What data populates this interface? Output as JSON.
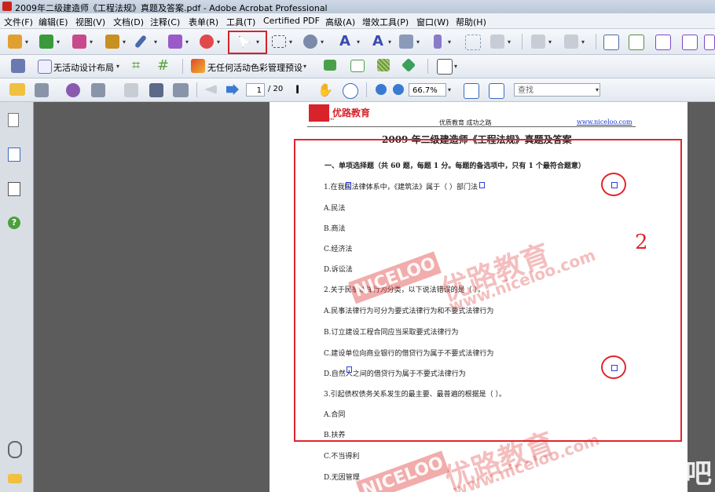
{
  "window": {
    "title": "2009年二级建造师《工程法规》真题及答案.pdf - Adobe Acrobat Professional"
  },
  "menubar": [
    "文件(F)",
    "编辑(E)",
    "视图(V)",
    "文档(D)",
    "注释(C)",
    "表单(R)",
    "工具(T)",
    "Certified PDF",
    "高级(A)",
    "增效工具(P)",
    "窗口(W)",
    "帮助(H)"
  ],
  "toolbar2": {
    "layout_label": "无活动设计布局",
    "color_label": "无任何活动色彩管理预设"
  },
  "toolbar3": {
    "page_current": "1",
    "page_total": "/ 20",
    "zoom": "66.7%",
    "search_placeholder": "查找"
  },
  "document": {
    "logo_text": "优路教育",
    "logo_sub": "niceloo.com",
    "header_left": "优质教育  成功之路",
    "header_link": "www.niceloo.com",
    "title": "2009 年二级建造师《工程法规》真题及答案",
    "section": "一、单项选择题（共 60 题，每题 1 分。每题的备选项中，只有 1 个最符合题意）",
    "lines": [
      "1.在我国法律体系中，《建筑法》属于（   ）部门法",
      "A.民法",
      "B.商法",
      "C.经济法",
      "D.诉讼法",
      "2.关于民事法律行为分类，以下说法错误的是（   ）。",
      "A.民事法律行为可分为要式法律行为和不要式法律行为",
      "B.订立建设工程合同应当采取要式法律行为",
      "C.建设单位向商业银行的借贷行为属于不要式法律行为",
      "D.自然人之间的借贷行为属于不要式法律行为",
      "3.引起债权债务关系发生的最主要、最普遍的根据是（   ）。",
      "A.合同",
      "B.扶养",
      "C.不当得利",
      "D.无因管理"
    ],
    "watermark_cn": "优路教育",
    "watermark_en": "www.niceloo.com",
    "watermark_brand": "NICELOO",
    "annotation_number": "2"
  },
  "corner_watermark": "下载吧"
}
